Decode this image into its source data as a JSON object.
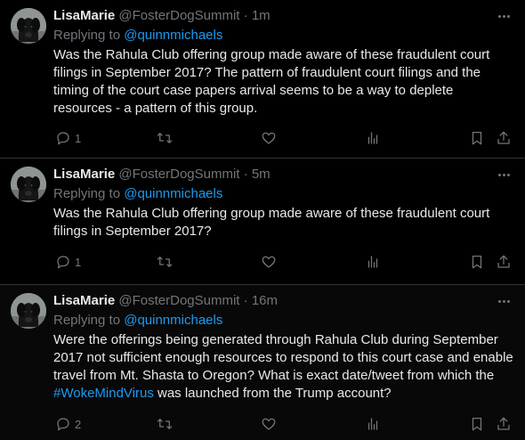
{
  "tweets": [
    {
      "name": "LisaMarie",
      "handle": "@FosterDogSummit",
      "time": "1m",
      "replying_prefix": "Replying to ",
      "replying_to": "@quinnmichaels",
      "text": "Was the Rahula Club offering group made aware of these fraudulent court filings in September 2017? The pattern of fraudulent court filings and the timing of the court case papers arrival seems to be a way to deplete resources - a pattern of this group.",
      "reply_count": "1",
      "retweet_count": "",
      "like_count": ""
    },
    {
      "name": "LisaMarie",
      "handle": "@FosterDogSummit",
      "time": "5m",
      "replying_prefix": "Replying to ",
      "replying_to": "@quinnmichaels",
      "text": "Was the Rahula Club offering group made aware of these fraudulent court filings in September 2017?",
      "reply_count": "1",
      "retweet_count": "",
      "like_count": ""
    },
    {
      "name": "LisaMarie",
      "handle": "@FosterDogSummit",
      "time": "16m",
      "replying_prefix": "Replying to ",
      "replying_to": "@quinnmichaels",
      "text_before_tag": "Were the offerings being generated through Rahula Club during September 2017 not sufficient enough resources to respond to this court case and enable travel from Mt. Shasta to Oregon? What is exact date/tweet from which the ",
      "hashtag": "#WokeMindVirus",
      "text_after_tag": " was launched from the Trump account?",
      "reply_count": "2",
      "retweet_count": "",
      "like_count": ""
    }
  ],
  "dot": "·",
  "icons": {
    "reply": "reply-icon",
    "retweet": "retweet-icon",
    "like": "heart-icon",
    "views": "views-icon",
    "bookmark": "bookmark-icon",
    "share": "share-icon",
    "more": "more-icon"
  },
  "colors": {
    "background": "#000000",
    "text": "#e7e9ea",
    "muted": "#71767b",
    "link": "#1d9bf0",
    "divider": "#2f3336"
  }
}
